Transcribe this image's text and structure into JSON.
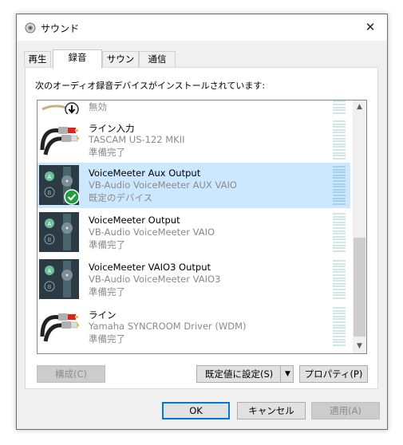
{
  "window": {
    "title": "サウンド",
    "close_label": "✕"
  },
  "tabs": [
    {
      "label": "再生",
      "active": false
    },
    {
      "label": "録音",
      "active": true
    },
    {
      "label": "サウンド",
      "active": false
    },
    {
      "label": "通信",
      "active": false
    }
  ],
  "panel": {
    "instruction": "次のオーディオ録音デバイスがインストールされています:"
  },
  "devices": [
    {
      "name": "",
      "description": "",
      "status": "無効",
      "icon": "disabled-device-icon",
      "selected": false
    },
    {
      "name": "ライン入力",
      "description": "TASCAM US-122 MKII",
      "status": "準備完了",
      "icon": "rca-cable-icon",
      "selected": false
    },
    {
      "name": "VoiceMeeter Aux Output",
      "description": "VB-Audio VoiceMeeter AUX VAIO",
      "status": "既定のデバイス",
      "icon": "voicemeeter-icon",
      "selected": true,
      "default_badge": "check-icon"
    },
    {
      "name": "VoiceMeeter Output",
      "description": "VB-Audio VoiceMeeter VAIO",
      "status": "準備完了",
      "icon": "voicemeeter-icon",
      "selected": false
    },
    {
      "name": "VoiceMeeter VAIO3 Output",
      "description": "VB-Audio VoiceMeeter VAIO3",
      "status": "準備完了",
      "icon": "voicemeeter-icon",
      "selected": false
    },
    {
      "name": "ライン",
      "description": "Yamaha SYNCROOM Driver (WDM)",
      "status": "準備完了",
      "icon": "rca-cable-icon",
      "selected": false
    }
  ],
  "panel_buttons": {
    "configure": "構成(C)",
    "set_default": "既定値に設定(S)",
    "properties": "プロパティ(P)"
  },
  "dialog_buttons": {
    "ok": "OK",
    "cancel": "キャンセル",
    "apply": "適用(A)"
  },
  "colors": {
    "selection": "#cce8ff",
    "accent": "#0078d7",
    "check": "#1e9e3e",
    "vm_green": "#6bbf9a"
  }
}
